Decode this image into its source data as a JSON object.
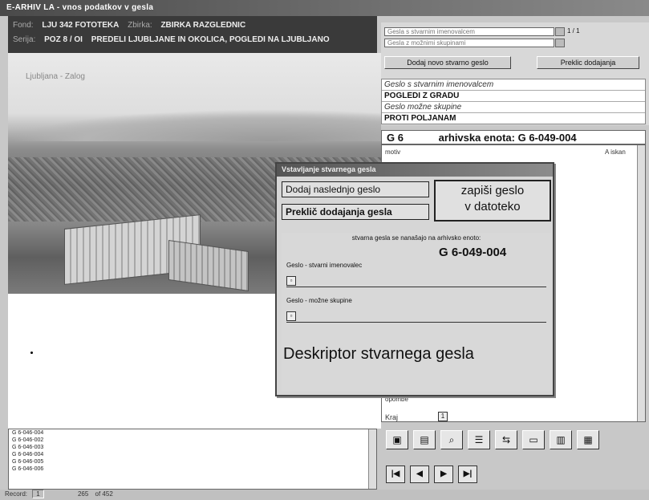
{
  "window": {
    "title": "E-ARHIV  LA - vnos podatkov v gesla"
  },
  "header": {
    "row1": {
      "label": "Fond:",
      "value": "LJU 342  FOTOTEKA",
      "label2": "Zbirka:",
      "value2": "ZBIRKA RAZGLEDNIC"
    },
    "row2": {
      "label": "Serija:",
      "value": "POZ 8 / OI",
      "value2": "PREDELI LJUBLJANE IN OKOLICA, POGLEDI NA LJUBLJANO"
    }
  },
  "photo": {
    "caption": "Ljubljana - Zalog"
  },
  "right_panel": {
    "combo1": "Gesla s stvarnim imenovalcem",
    "combo2": "Gesla z možnimi skupinami",
    "combo_counter": "1 / 1",
    "add_keyword_button": "Dodaj novo stvarno geslo",
    "kw_button2": "Preklic dodajanja",
    "kw_label1": "Geslo s stvarnim imenovalcem",
    "kw_value1": "POGLEDI Z GRADU",
    "kw_label2": "Geslo možne skupine",
    "kw_value2": "PROTI POLJANAM"
  },
  "archive": {
    "prefix": "G 6",
    "title": "arhivska enota:",
    "code": "G 6-049-004",
    "motiv_label": "motiv",
    "a_label": "A iskan",
    "notes_label": "opombe",
    "bottom_label": "Kraj",
    "bottom_value": "1"
  },
  "dialog": {
    "title": "Vstavljanje stvarnega gesla",
    "add_next_button": "Dodaj naslednjo geslo",
    "cancel_button": "Preklič dodajanja gesla",
    "save_button_line1": "zapiši geslo",
    "save_button_line2": "v datoteko",
    "info_text": "stvarna gesla se nanašajo na arhivsko enoto:",
    "unit_code": "G 6-049-004",
    "field1_label": "Geslo - stvarni imenovalec",
    "field2_label": "Geslo - možne skupine",
    "descriptor": "Deskriptor stvarnega gesla"
  },
  "left_list": {
    "items": [
      "G 6-046-004",
      "G 6-046-002",
      "G 6-046-003",
      "G 6-046-004",
      "G 6-046-005",
      "G 6-046-006"
    ]
  },
  "toolbar": {
    "icons": [
      "record-icon",
      "form-icon",
      "search-icon",
      "list-icon",
      "filter-icon",
      "gallery-icon",
      "chart-icon",
      "print-icon"
    ],
    "nav": [
      "|◀",
      "◀",
      "▶",
      "▶|"
    ]
  },
  "statusbar": {
    "record_label": "Record:",
    "record_value": "1",
    "position": "265",
    "of_total": "of 452"
  }
}
